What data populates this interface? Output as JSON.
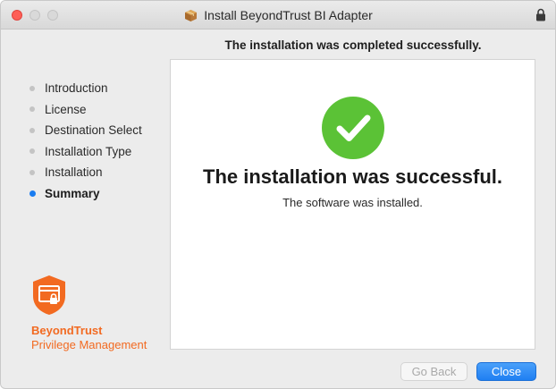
{
  "window": {
    "title": "Install BeyondTrust BI Adapter",
    "title_icon": "package-icon",
    "lock_icon": "lock-icon"
  },
  "header": {
    "message": "The installation was completed successfully."
  },
  "sidebar": {
    "steps": [
      {
        "label": "Introduction",
        "active": false
      },
      {
        "label": "License",
        "active": false
      },
      {
        "label": "Destination Select",
        "active": false
      },
      {
        "label": "Installation Type",
        "active": false
      },
      {
        "label": "Installation",
        "active": false
      },
      {
        "label": "Summary",
        "active": true
      }
    ],
    "brand": {
      "name": "BeyondTrust",
      "product": "Privilege Management",
      "color": "#f26a21"
    }
  },
  "main": {
    "status_icon": "check-circle-icon",
    "status_color": "#5bc236",
    "title": "The installation was successful.",
    "subtitle": "The software was installed."
  },
  "buttons": {
    "back_label": "Go Back",
    "back_enabled": false,
    "close_label": "Close"
  }
}
